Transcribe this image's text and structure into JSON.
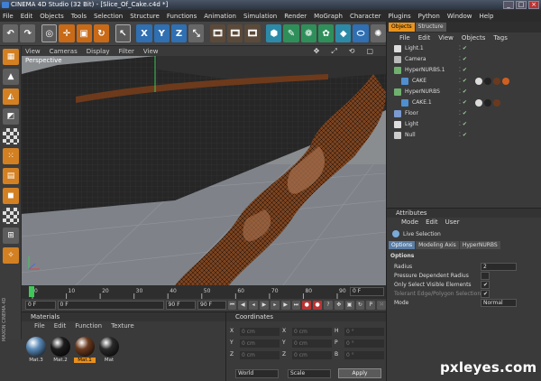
{
  "window": {
    "title": "CINEMA 4D Studio (32 Bit) - [Slice_Of_Cake.c4d *]"
  },
  "menu": [
    "File",
    "Edit",
    "Objects",
    "Tools",
    "Selection",
    "Structure",
    "Functions",
    "Animation",
    "Simulation",
    "Render",
    "MoGraph",
    "Character",
    "Plugins",
    "Python",
    "Window",
    "Help"
  ],
  "toolbar": {
    "axis_labels": [
      "X",
      "Y",
      "Z"
    ]
  },
  "viewport": {
    "menu": [
      "View",
      "Cameras",
      "Display",
      "Filter",
      "View"
    ],
    "label": "Perspective"
  },
  "timeline": {
    "ticks": [
      "0",
      "10",
      "20",
      "30",
      "40",
      "50",
      "60",
      "70",
      "80",
      "90"
    ],
    "current_frame": "0 F",
    "start_field": "0 F",
    "mid_field": "0 F",
    "end_field": "90 F",
    "end_field2": "90 F"
  },
  "materials": {
    "header": "Materials",
    "menu": [
      "File",
      "Edit",
      "Function",
      "Texture"
    ],
    "items": [
      {
        "label": "Mat.3",
        "color": "#5a8ab8",
        "selected": false
      },
      {
        "label": "Mat.2",
        "color": "#1c1c1c",
        "selected": false
      },
      {
        "label": "Mat.1",
        "color": "#6b3a1e",
        "selected": true
      },
      {
        "label": "Mat",
        "color": "#2a2a2a",
        "selected": false
      }
    ]
  },
  "coordinates": {
    "header": "Coordinates",
    "rows": [
      {
        "a": "X",
        "av": "0 cm",
        "b": "X",
        "bv": "0 cm",
        "c": "H",
        "cv": "0 °"
      },
      {
        "a": "Y",
        "av": "0 cm",
        "b": "Y",
        "bv": "0 cm",
        "c": "P",
        "cv": "0 °"
      },
      {
        "a": "Z",
        "av": "0 cm",
        "b": "Z",
        "bv": "0 cm",
        "c": "B",
        "cv": "0 °"
      }
    ],
    "world": "World",
    "scale": "Scale",
    "apply": "Apply"
  },
  "objects_panel": {
    "tabs": [
      "Objects",
      "Structure"
    ],
    "menu": [
      "File",
      "Edit",
      "View",
      "Objects",
      "Tags"
    ],
    "items": [
      {
        "name": "Light.1",
        "icon": "light-icon",
        "level": 0
      },
      {
        "name": "Camera",
        "icon": "camera-icon",
        "level": 0
      },
      {
        "name": "HyperNURBS.1",
        "icon": "hypernurbs-icon",
        "level": 0
      },
      {
        "name": "CAKE",
        "icon": "polygon-icon",
        "level": 1
      },
      {
        "name": "HyperNURBS",
        "icon": "hypernurbs-icon",
        "level": 0
      },
      {
        "name": "CAKE.1",
        "icon": "polygon-icon",
        "level": 1
      },
      {
        "name": "Floor",
        "icon": "floor-icon",
        "level": 0
      },
      {
        "name": "Light",
        "icon": "light-icon",
        "level": 0
      },
      {
        "name": "Null",
        "icon": "null-icon",
        "level": 0
      }
    ]
  },
  "attributes_panel": {
    "header": "Attributes",
    "menu": [
      "Mode",
      "Edit",
      "User"
    ],
    "tool": "Live Selection",
    "tabs": [
      "Options",
      "Modeling Axis",
      "HyperNURBS"
    ],
    "section": "Options",
    "fields": [
      {
        "label": "Radius",
        "value": "2"
      },
      {
        "label": "Pressure Dependent Radius",
        "value": ""
      },
      {
        "label": "Only Select Visible Elements",
        "value": "✔"
      },
      {
        "label": "Tolerant Edge/Polygon Selection",
        "value": "✔"
      },
      {
        "label": "Mode",
        "value": "Normal"
      }
    ]
  },
  "branding": {
    "side_logo": "MAXON CINEMA 4D",
    "watermark": "pxleyes.com"
  }
}
